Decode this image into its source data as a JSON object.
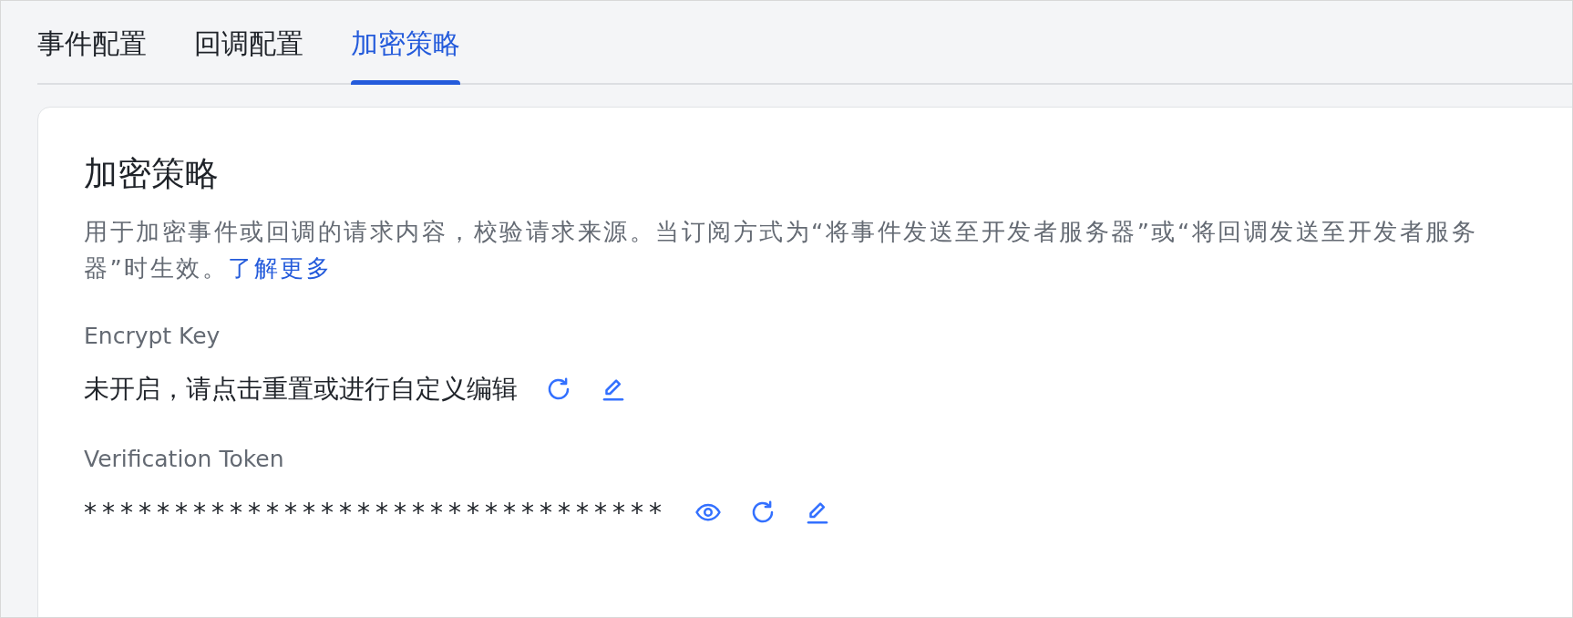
{
  "tabs": [
    {
      "label": "事件配置",
      "selected": false
    },
    {
      "label": "回调配置",
      "selected": false
    },
    {
      "label": "加密策略",
      "selected": true
    }
  ],
  "section": {
    "title": "加密策略",
    "description": "用于加密事件或回调的请求内容，校验请求来源。当订阅方式为“将事件发送至开发者服务器”或“将回调发送至开发者服务器”时生效。",
    "link": "了解更多"
  },
  "fields": [
    {
      "label": "Encrypt Key",
      "value": "未开启，请点击重置或进行自定义编辑",
      "kind": "text",
      "actions": [
        {
          "kind": "refresh"
        },
        {
          "kind": "edit"
        }
      ]
    },
    {
      "label": "Verification Token",
      "value": "********************************",
      "kind": "masked",
      "actions": [
        {
          "kind": "view"
        },
        {
          "kind": "refresh"
        },
        {
          "kind": "edit"
        }
      ]
    }
  ]
}
